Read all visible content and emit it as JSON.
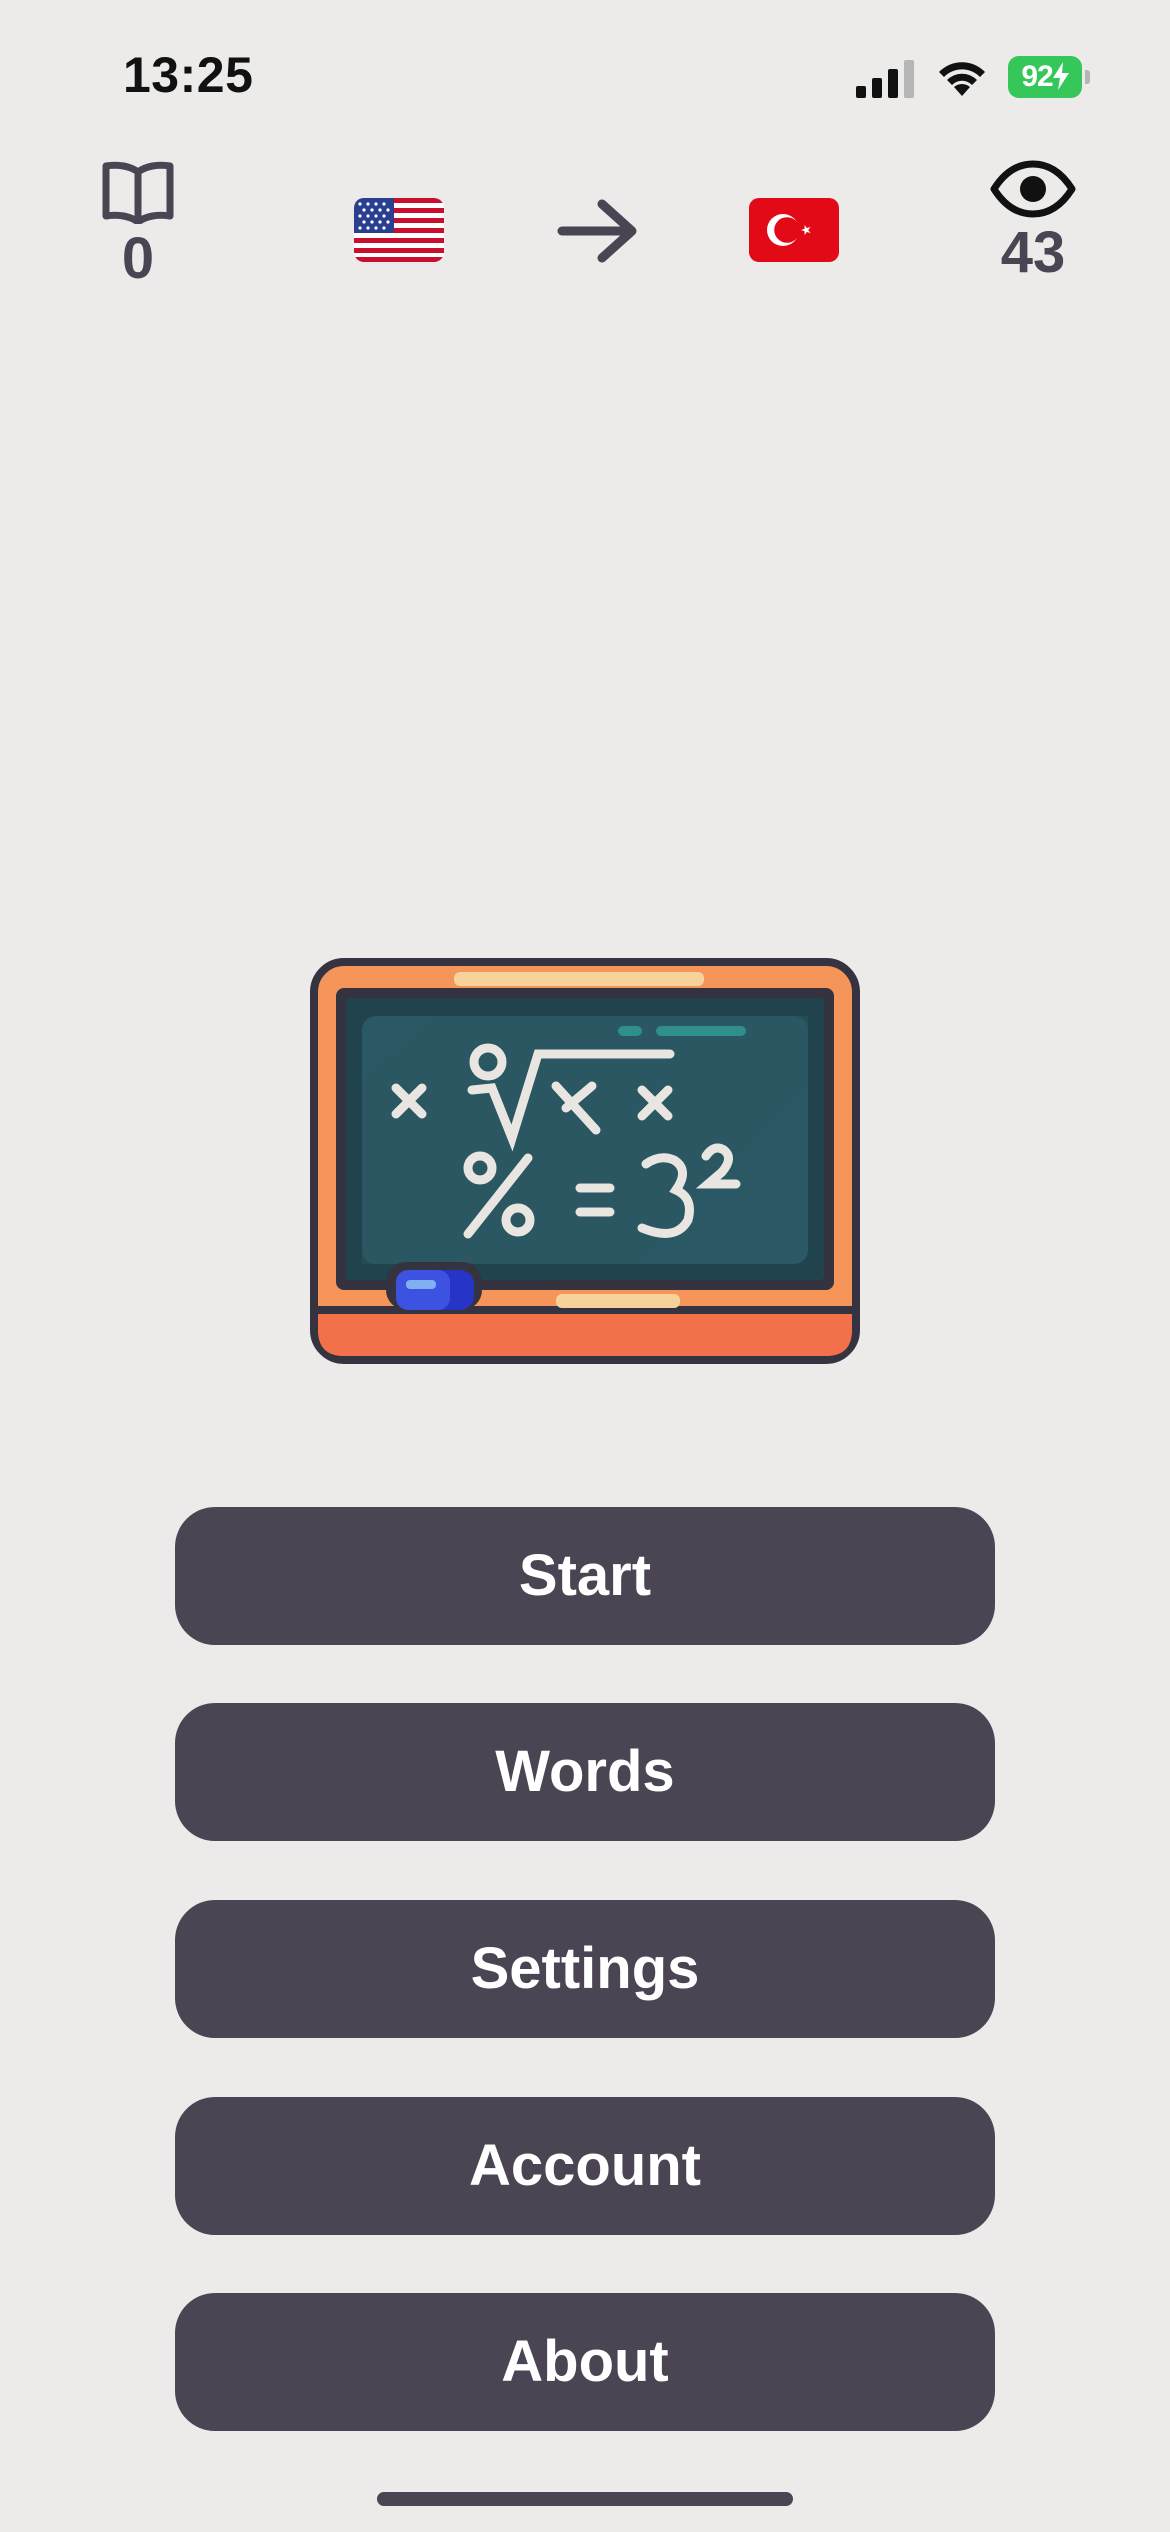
{
  "status_bar": {
    "time": "13:25",
    "battery_level": "92",
    "battery_charging": true,
    "battery_color": "#35c759",
    "signal_icon": "cellular-signal-icon",
    "wifi_icon": "wifi-icon"
  },
  "header": {
    "learned_icon": "book-icon",
    "learned_count": "0",
    "from_language_icon": "us-flag-icon",
    "direction_icon": "arrow-right-icon",
    "to_language_icon": "turkey-flag-icon",
    "viewed_icon": "eye-icon",
    "viewed_count": "43"
  },
  "illustration": {
    "icon": "chalkboard-math-icon"
  },
  "menu": {
    "start_label": "Start",
    "words_label": "Words",
    "settings_label": "Settings",
    "account_label": "Account",
    "about_label": "About"
  },
  "colors": {
    "background": "#ecebe9",
    "button": "#4a4453",
    "button_text": "#ffffff",
    "accent_orange": "#f6955a"
  }
}
